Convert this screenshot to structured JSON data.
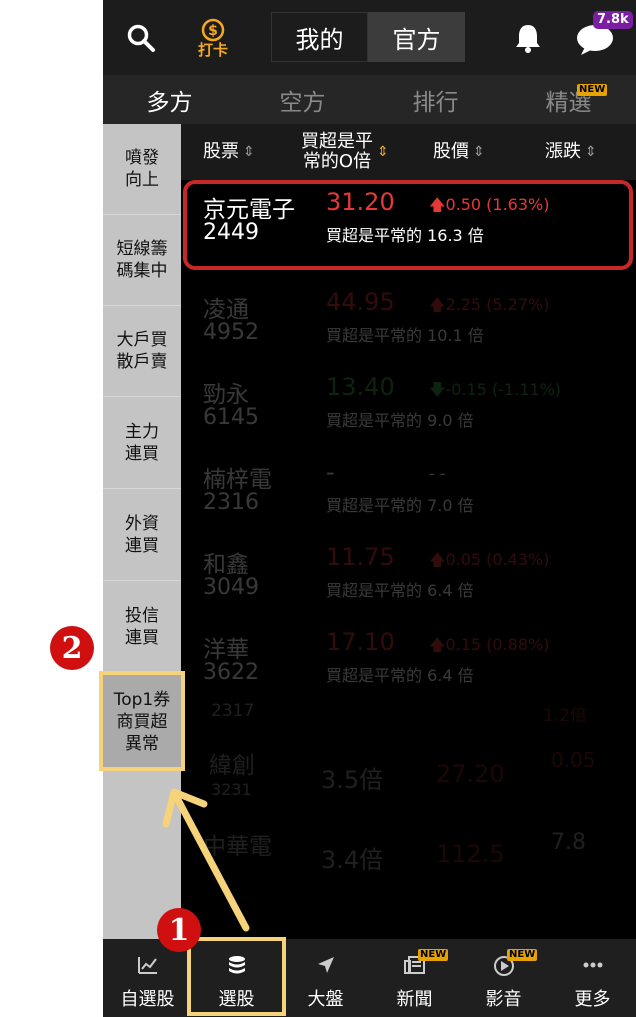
{
  "topbar": {
    "checkin_label": "打卡",
    "tab_mine": "我的",
    "tab_official": "官方",
    "chat_badge": "7.8k"
  },
  "tabs": [
    {
      "label": "多方",
      "active": true
    },
    {
      "label": "空方",
      "active": false
    },
    {
      "label": "排行",
      "active": false
    },
    {
      "label": "精選",
      "active": false,
      "badge": "NEW"
    }
  ],
  "sidebar": [
    {
      "line1": "噴發",
      "line2": "向上"
    },
    {
      "line1": "短線籌",
      "line2": "碼集中"
    },
    {
      "line1": "大戶買",
      "line2": "散戶賣"
    },
    {
      "line1": "主力",
      "line2": "連買"
    },
    {
      "line1": "外資",
      "line2": "連買"
    },
    {
      "line1": "投信",
      "line2": "連買"
    },
    {
      "line1": "Top1券",
      "line2": "商買超",
      "line3": "異常"
    }
  ],
  "columns": {
    "stock": "股票",
    "buy_ratio_line1": "買超是平",
    "buy_ratio_line2": "常的O倍",
    "price": "股價",
    "change": "漲跌"
  },
  "rows": [
    {
      "name": "京元電子",
      "code": "2449",
      "price": "31.20",
      "change": "0.50 (1.63%)",
      "dir": "up",
      "desc": "買超是平常的 16.3 倍"
    },
    {
      "name": "凌通",
      "code": "4952",
      "price": "44.95",
      "change": "2.25 (5.27%)",
      "dir": "up",
      "desc": "買超是平常的 10.1 倍"
    },
    {
      "name": "勁永",
      "code": "6145",
      "price": "13.40",
      "change": "-0.15 (-1.11%)",
      "dir": "down",
      "desc": "買超是平常的 9.0 倍"
    },
    {
      "name": "楠梓電",
      "code": "2316",
      "price": "-",
      "change": "- -",
      "dir": "none",
      "desc": "買超是平常的 7.0 倍"
    },
    {
      "name": "和鑫",
      "code": "3049",
      "price": "11.75",
      "change": "0.05 (0.43%)",
      "dir": "up",
      "desc": "買超是平常的 6.4 倍"
    },
    {
      "name": "洋華",
      "code": "3622",
      "price": "17.10",
      "change": "0.15 (0.88%)",
      "dir": "up",
      "desc": "買超是平常的 6.4 倍"
    }
  ],
  "ghost_rows": [
    {
      "code": "2317",
      "col3": "1.2倍"
    },
    {
      "name": "緯創",
      "code": "3231",
      "ratio": "3.5倍",
      "price": "27.20",
      "change": "0.05"
    },
    {
      "name": "中華電",
      "ratio": "3.4倍",
      "price": "112.5",
      "change": "7.8"
    }
  ],
  "bottom_nav": [
    {
      "label": "自選股",
      "icon": "chart-icon"
    },
    {
      "label": "選股",
      "icon": "database-icon"
    },
    {
      "label": "大盤",
      "icon": "navigation-arrow-icon"
    },
    {
      "label": "新聞",
      "icon": "news-icon",
      "badge": "NEW"
    },
    {
      "label": "影音",
      "icon": "play-icon",
      "badge": "NEW"
    },
    {
      "label": "更多",
      "icon": "more-dots-icon"
    }
  ],
  "annotations": {
    "marker1": "1",
    "marker2": "2"
  },
  "colors": {
    "up": "#e53935",
    "down": "#43a047",
    "highlight_border": "#c62828",
    "annotation_box": "#f6d27a",
    "marker": "#d01010"
  }
}
